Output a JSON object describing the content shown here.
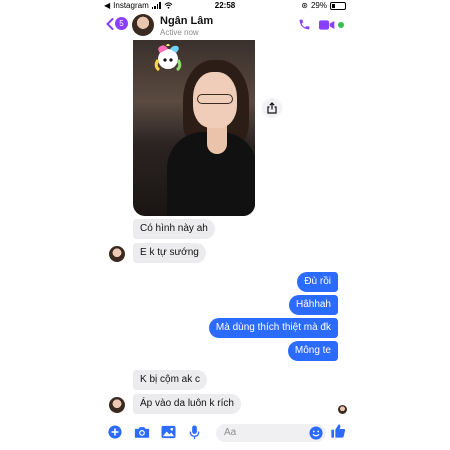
{
  "status_bar": {
    "back_app": "Instagram",
    "time": "22:58",
    "battery": "29%",
    "battery_level": 0.29
  },
  "header": {
    "unread_count": "5",
    "contact_name": "Ngân Lâm",
    "presence": "Active now",
    "icons": [
      "back-chevron-icon",
      "phone-icon",
      "video-call-icon"
    ],
    "accent_color": "#8a3ffc",
    "active_dot_color": "#31c24d"
  },
  "messages": [
    {
      "direction": "in",
      "text": "Có hình này ah"
    },
    {
      "direction": "in",
      "text": "E k tự sướng"
    },
    {
      "direction": "out",
      "text": "Đù rồi"
    },
    {
      "direction": "out",
      "text": "Hâhhah"
    },
    {
      "direction": "out",
      "text": "Mà dùng thích thiệt mà đk"
    },
    {
      "direction": "out",
      "text": "Mông te"
    },
    {
      "direction": "in",
      "text": "K bị cộm ak c"
    },
    {
      "direction": "in",
      "text": "Áp vào da luôn k rích"
    }
  ],
  "colors": {
    "outgoing_bubble": "#2c6bff",
    "incoming_bubble": "#ececef",
    "composer_icons": "#2c6bff"
  },
  "composer": {
    "placeholder": "Aa",
    "icons": [
      "plus-icon",
      "camera-icon",
      "gallery-icon",
      "microphone-icon",
      "emoji-icon",
      "like-thumb-icon"
    ]
  }
}
